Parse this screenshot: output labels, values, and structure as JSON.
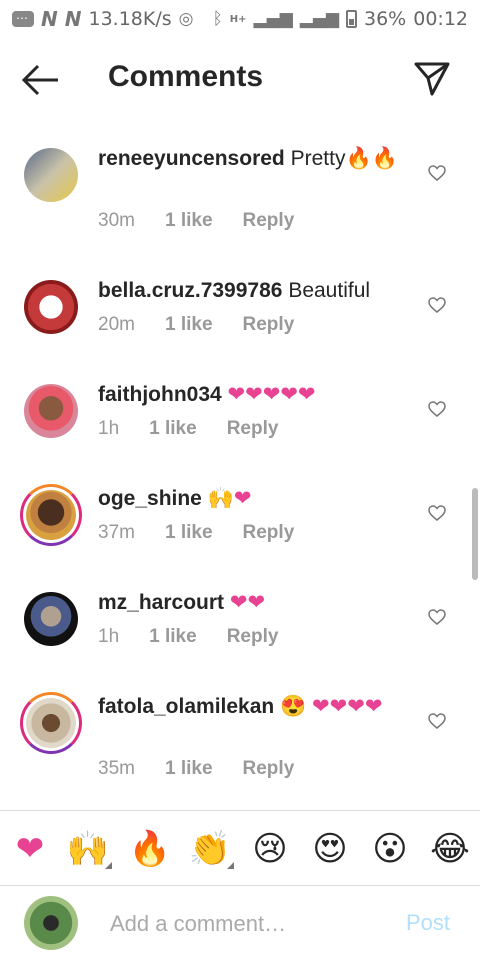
{
  "status_bar": {
    "speed": "13.18K/s",
    "network": "H+",
    "battery": "36%",
    "time": "00:12",
    "icons": [
      "message-icon",
      "n-icon",
      "n-icon",
      "wifi-hotspot-icon",
      "bluetooth-icon",
      "signal-icon",
      "signal-icon",
      "battery-icon"
    ]
  },
  "header": {
    "title": "Comments",
    "back_icon": "back-arrow-icon",
    "send_icon": "send-paper-plane-icon"
  },
  "comments": [
    {
      "username": "reneeyuncensored",
      "text": "Pretty🔥🔥",
      "time": "30m",
      "likes": "1 like",
      "reply": "Reply",
      "story_ring": false
    },
    {
      "username": "bella.cruz.7399786",
      "text": "Beautiful",
      "time": "20m",
      "likes": "1 like",
      "reply": "Reply",
      "story_ring": false
    },
    {
      "username": "faithjohn034",
      "text": "❤❤❤❤❤",
      "time": "1h",
      "likes": "1 like",
      "reply": "Reply",
      "story_ring": false
    },
    {
      "username": "oge_shine",
      "text": "🙌❤",
      "time": "37m",
      "likes": "1 like",
      "reply": "Reply",
      "story_ring": true
    },
    {
      "username": "mz_harcourt",
      "text": "❤❤",
      "time": "1h",
      "likes": "1 like",
      "reply": "Reply",
      "story_ring": false
    },
    {
      "username": "fatola_olamilekan",
      "text": "😍 ❤❤❤❤",
      "time": "35m",
      "likes": "1 like",
      "reply": "Reply",
      "story_ring": true
    }
  ],
  "emoji_bar": [
    "❤",
    "🙌",
    "🔥",
    "👏",
    "😢",
    "😍",
    "😮",
    "😂"
  ],
  "compose": {
    "placeholder": "Add a comment…",
    "post_label": "Post"
  },
  "colors": {
    "post_disabled": "#b2dffc",
    "meta_gray": "#999999",
    "heart_pink": "#e84393"
  }
}
